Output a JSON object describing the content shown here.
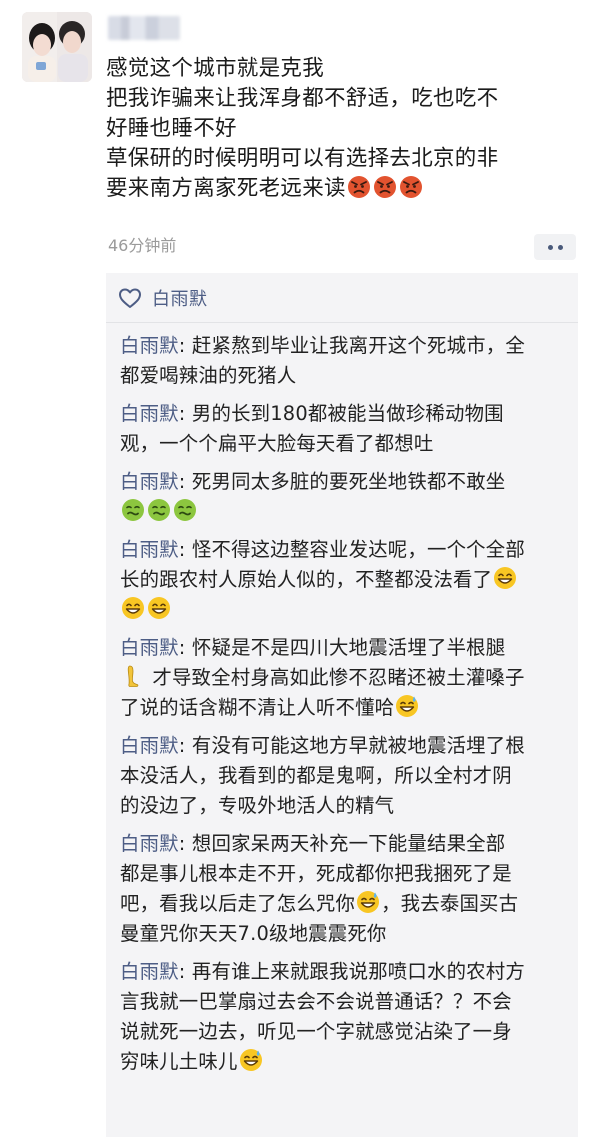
{
  "post": {
    "lines": [
      "感觉这个城市就是克我",
      "把我诈骗来让我浑身都不舒适，吃也吃不",
      "好睡也睡不好",
      "草保研的时候明明可以有选择去北京的非",
      "要来南方离家死老远来读"
    ],
    "time": "46分钟前"
  },
  "likes": {
    "name": "白雨默"
  },
  "comments": [
    {
      "author": "白雨默",
      "sep": ": ",
      "lines": [
        "赶紧熬到毕业让我离开这个死城市，全",
        "都爱喝辣油的死猪人"
      ]
    },
    {
      "author": "白雨默",
      "sep": ": ",
      "lines": [
        "男的长到180都被能当做珍稀动物围",
        "观，一个个扁平大脸每天看了都想吐"
      ]
    },
    {
      "author": "白雨默",
      "sep": ": ",
      "lines": [
        "死男同太多脏的要死坐地铁都不敢坐",
        ""
      ]
    },
    {
      "author": "白雨默",
      "sep": ": ",
      "lines": [
        "怪不得这边整容业发达呢，一个个全部",
        "长的跟农村人原始人似的，不整都没法看了",
        ""
      ]
    },
    {
      "author": "白雨默",
      "sep": ": ",
      "lines": [
        "怀疑是不是四川大地震活埋了半根腿",
        "才导致全村身高如此惨不忍睹还被土灌嗓子",
        "了说的话含糊不清让人听不懂哈"
      ]
    },
    {
      "author": "白雨默",
      "sep": ": ",
      "lines": [
        "有没有可能这地方早就被地震活埋了根",
        "本没活人，我看到的都是鬼啊，所以全村才阴",
        "的没边了，专吸外地活人的精气"
      ]
    },
    {
      "author": "白雨默",
      "sep": ": ",
      "lines": [
        "想回家呆两天补充一下能量结果全部",
        "都是事儿根本走不开，死成都你把我捆死了是",
        "吧，看我以后走了怎么咒你",
        "，我去泰国买古",
        "曼童咒你天天7.0级地震震死你"
      ]
    },
    {
      "author": "白雨默",
      "sep": ": ",
      "lines": [
        "再有谁上来就跟我说那喷口水的农村方",
        "言我就一巴掌扇过去会不会说普通话？？不会",
        "说就死一边去，听见一个字就感觉沾染了一身",
        "穷味儿土味儿"
      ]
    }
  ],
  "colors": {
    "author": "#4d5d85",
    "text": "#1b1b1b",
    "time": "#9a9a9a",
    "box": "#f4f4f6"
  },
  "icons": {
    "angry": "angry-face-icon",
    "sick": "nauseated-face-icon",
    "grin": "grinning-face-icon",
    "sweat": "grinning-sweat-face-icon",
    "leg": "leg-icon",
    "heart": "heart-outline-icon"
  }
}
